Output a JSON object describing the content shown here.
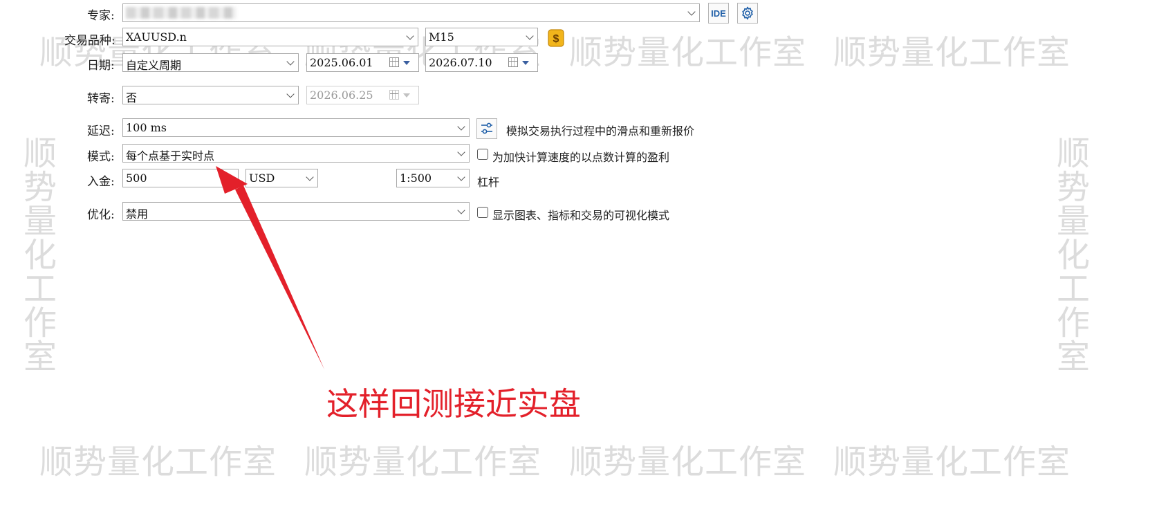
{
  "watermark": {
    "text": "顺势量化工作室"
  },
  "form": {
    "expert": {
      "label": "专家:"
    },
    "symbol": {
      "label": "交易品种:",
      "value": "XAUUSD.n",
      "timeframe": "M15"
    },
    "date": {
      "label": "日期:",
      "value": "自定义周期",
      "from": "2025.06.01",
      "to": "2026.07.10"
    },
    "forward": {
      "label": "转寄:",
      "value": "否",
      "date": "2026.06.25"
    },
    "delay": {
      "label": "延迟:",
      "value": "100 ms",
      "note": "模拟交易执行过程中的滑点和重新报价"
    },
    "mode": {
      "label": "模式:",
      "value": "每个点基于实时点",
      "checkbox_label": "为加快计算速度的以点数计算的盈利",
      "checked": false
    },
    "deposit": {
      "label": "入金:",
      "value": "500",
      "currency": "USD",
      "leverage": "1:500",
      "leverage_label": "杠杆"
    },
    "optimization": {
      "label": "优化:",
      "value": "禁用",
      "checkbox_label": "显示图表、指标和交易的可视化模式",
      "checked": false
    }
  },
  "toolbar": {
    "ide_label": "IDE"
  },
  "annotation": {
    "text": "这样回测接近实盘",
    "color": "#e3202a"
  },
  "icons": {
    "settings": "gear-icon",
    "symbol_info": "dollar-icon",
    "delay_settings": "sliders-icon"
  }
}
